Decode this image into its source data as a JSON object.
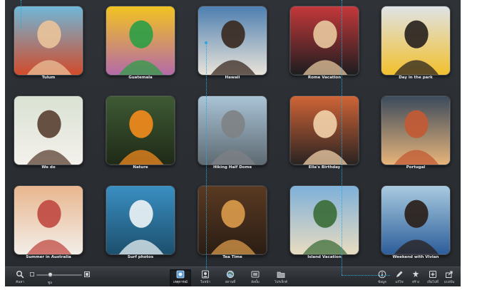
{
  "events": [
    {
      "name": "Tulum",
      "colors": [
        "#6fb8d8",
        "#e8c29a",
        "#d14b2b"
      ]
    },
    {
      "name": "Guatemala",
      "colors": [
        "#f2c321",
        "#2f9e47",
        "#b46aa8"
      ]
    },
    {
      "name": "Hawaii",
      "colors": [
        "#4d7fb0",
        "#3a2a22",
        "#e9e3d9"
      ]
    },
    {
      "name": "Rome Vacation",
      "colors": [
        "#c4383a",
        "#e6c59d",
        "#1d1d1f"
      ]
    },
    {
      "name": "Day in the park",
      "colors": [
        "#dfe3e6",
        "#2a2320",
        "#f2c02d"
      ]
    },
    {
      "name": "We do",
      "colors": [
        "#d9e2d3",
        "#5b4233",
        "#f4f1ec"
      ]
    },
    {
      "name": "Nature",
      "colors": [
        "#3e5a34",
        "#f08a1d",
        "#1f2a17"
      ]
    },
    {
      "name": "Hiking Half Dome",
      "colors": [
        "#a9c3d6",
        "#7e8285",
        "#5e6a72"
      ]
    },
    {
      "name": "Ella's Birthday",
      "colors": [
        "#cf6436",
        "#f0cfa8",
        "#2a2322"
      ]
    },
    {
      "name": "Portugal",
      "colors": [
        "#3b4a5c",
        "#c25a34",
        "#e7b47a"
      ]
    },
    {
      "name": "Summer in Australia",
      "colors": [
        "#e8b68e",
        "#c04b43",
        "#f3eee8"
      ]
    },
    {
      "name": "Surf photos",
      "colors": [
        "#3a8fc2",
        "#e9f1f4",
        "#1c4f6d"
      ]
    },
    {
      "name": "Tea Time",
      "colors": [
        "#5a3a22",
        "#d89a4a",
        "#2a1d14"
      ]
    },
    {
      "name": "Island Vacation",
      "colors": [
        "#7eb0d9",
        "#3c6e3a",
        "#e9dcc0"
      ]
    },
    {
      "name": "Weekend with Vivian",
      "colors": [
        "#a9cbe0",
        "#2a1f1b",
        "#2c5d9a"
      ]
    }
  ],
  "toolbar": {
    "search_label": "ค้นหา",
    "zoom_label": "ซูม",
    "zoom_level": 0.3,
    "nav": [
      {
        "label": "เหตุการณ์",
        "icon": "events-icon",
        "active": true
      },
      {
        "label": "ใบหน้า",
        "icon": "faces-icon",
        "active": false
      },
      {
        "label": "สถานที่",
        "icon": "places-icon",
        "active": false
      },
      {
        "label": "อัลบั้ม",
        "icon": "albums-icon",
        "active": false
      },
      {
        "label": "โปรเจ็กต์",
        "icon": "projects-icon",
        "active": false
      }
    ],
    "actions": [
      {
        "label": "ข้อมูล",
        "icon": "info-icon"
      },
      {
        "label": "แก้ไข",
        "icon": "edit-icon"
      },
      {
        "label": "สร้าง",
        "icon": "create-icon"
      },
      {
        "label": "เพิ่มไปที่",
        "icon": "add-to-icon"
      },
      {
        "label": "แบ่งปัน",
        "icon": "share-icon"
      }
    ]
  },
  "accent_color": "#27a8e0"
}
